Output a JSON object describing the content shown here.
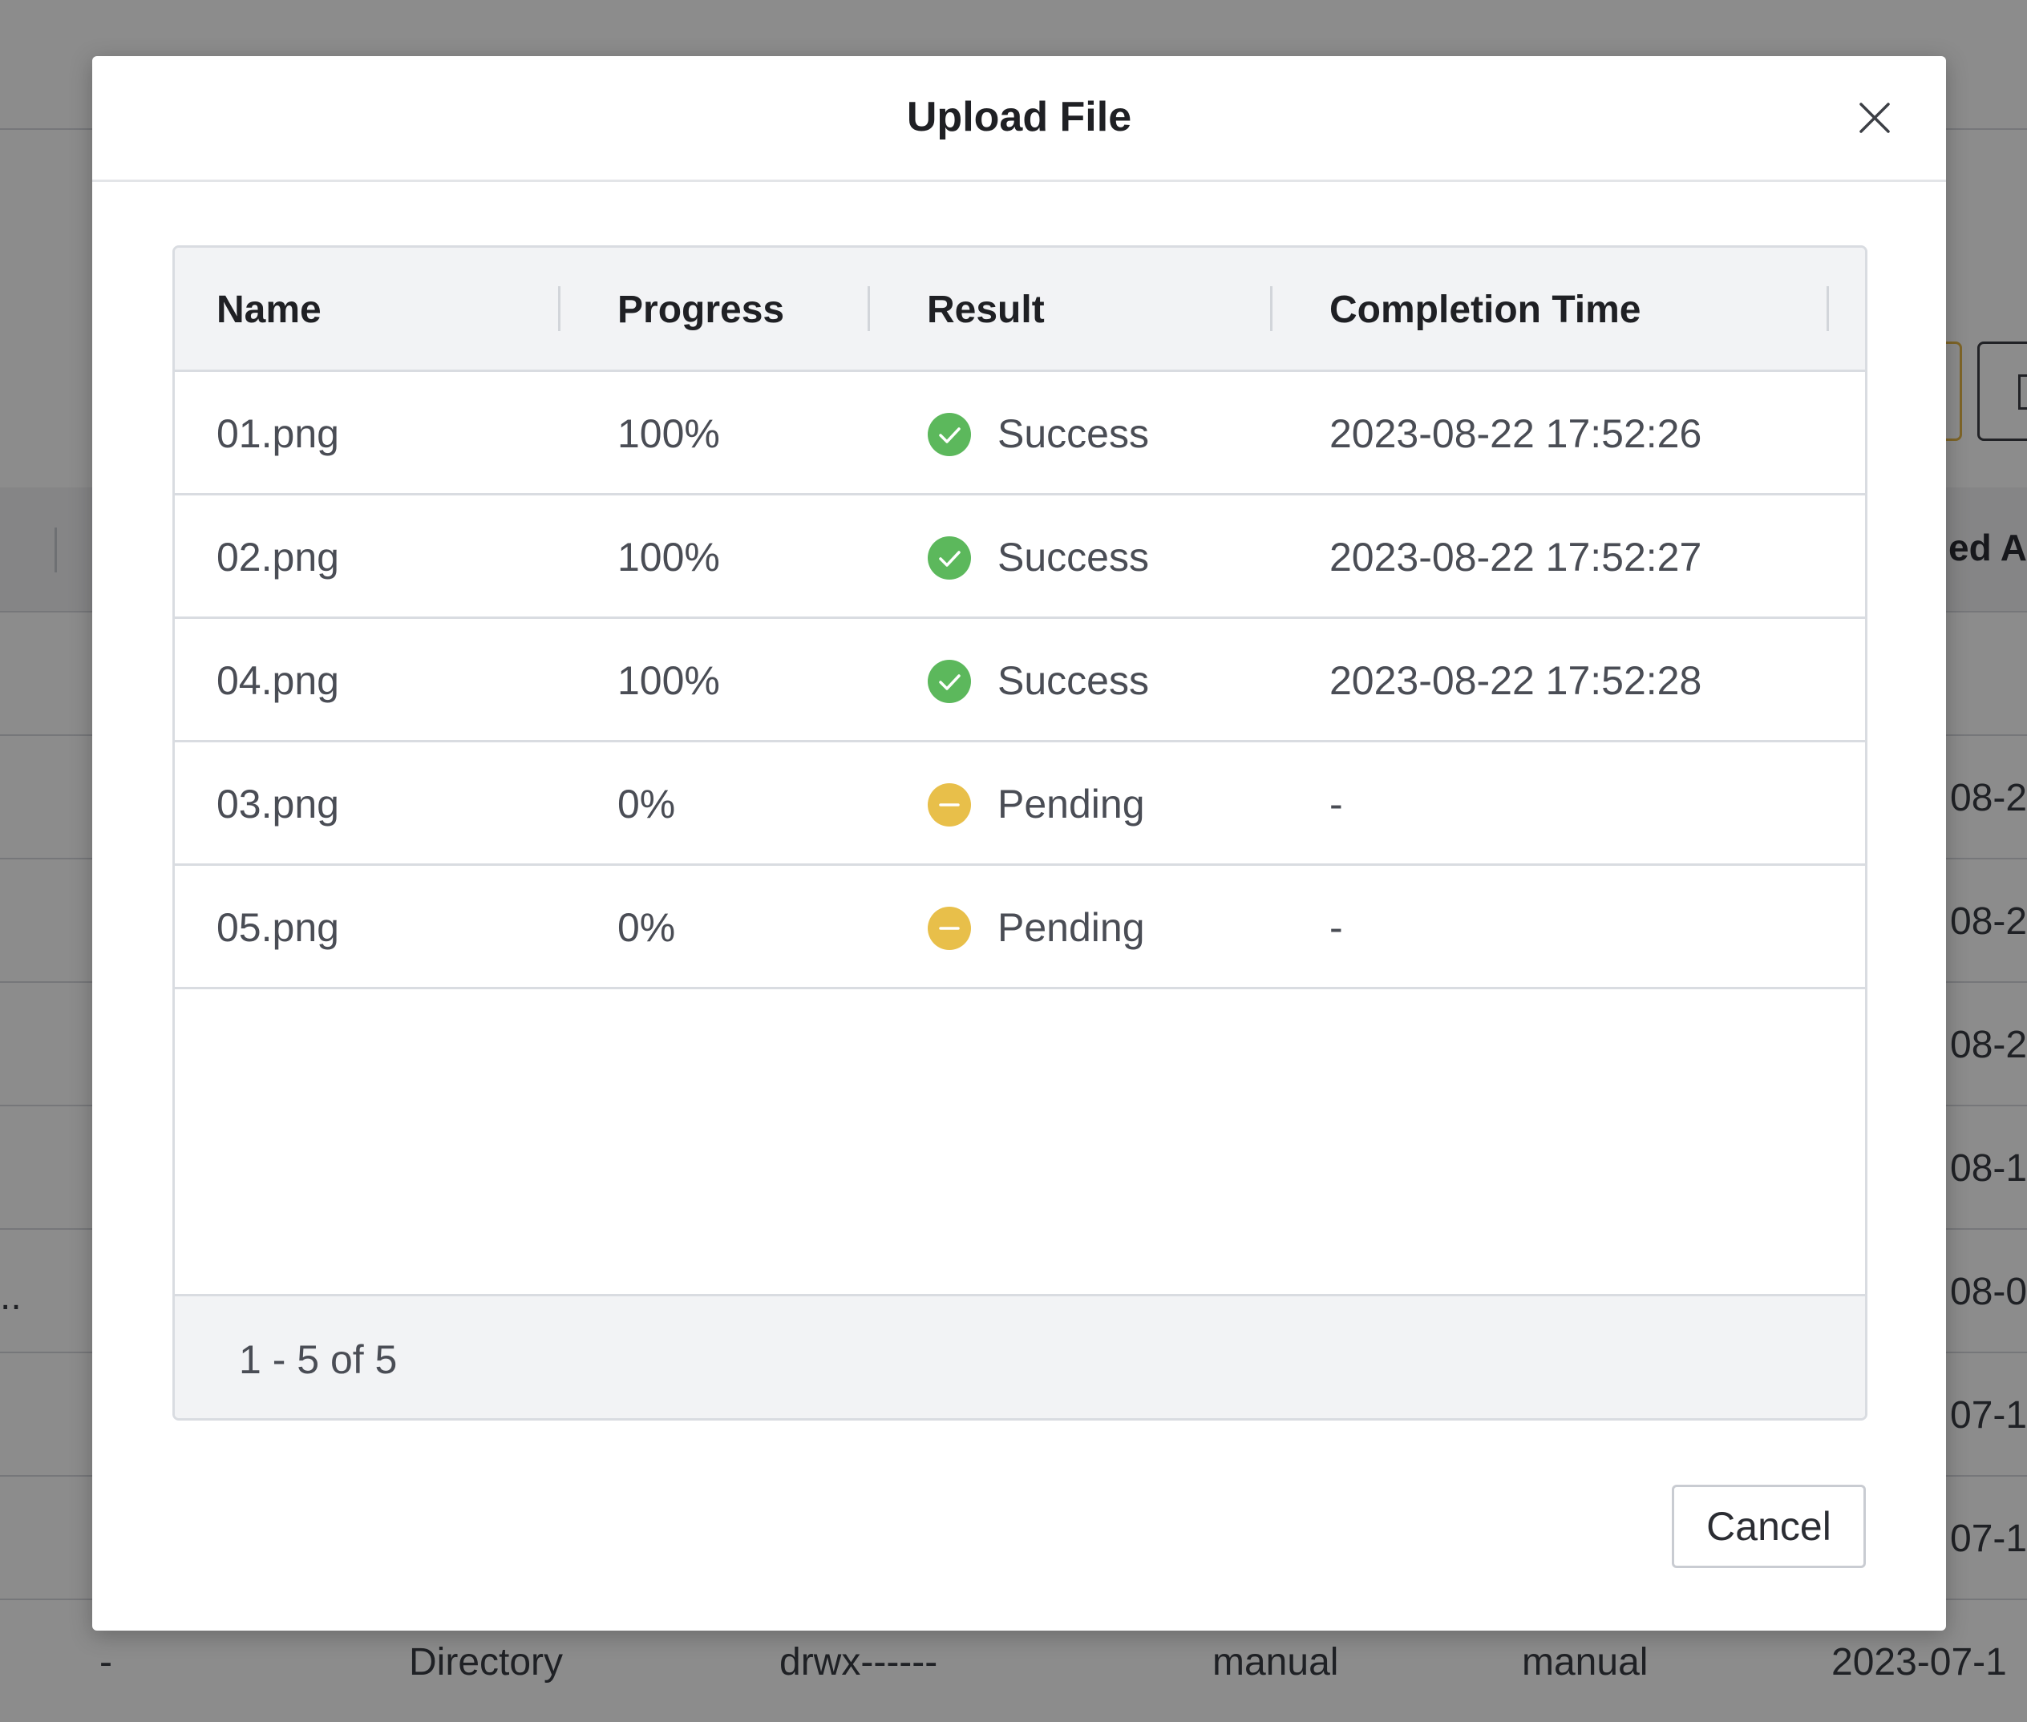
{
  "background": {
    "header_fragment": "ed A",
    "dates": [
      "08-2",
      "08-2",
      "08-2",
      "08-1",
      "08-0",
      "07-1",
      "07-1"
    ],
    "ellipsis": "..",
    "bottom_row": {
      "name": "-",
      "type": "Directory",
      "permissions": "drwx------",
      "owner": "manual",
      "group": "manual",
      "date": "2023-07-1"
    }
  },
  "modal": {
    "title": "Upload File",
    "close_icon": "close-icon",
    "columns": [
      "Name",
      "Progress",
      "Result",
      "Completion Time"
    ],
    "rows": [
      {
        "name": "01.png",
        "progress": "100%",
        "result": "Success",
        "status": "success",
        "completion_time": "2023-08-22 17:52:26"
      },
      {
        "name": "02.png",
        "progress": "100%",
        "result": "Success",
        "status": "success",
        "completion_time": "2023-08-22 17:52:27"
      },
      {
        "name": "04.png",
        "progress": "100%",
        "result": "Success",
        "status": "success",
        "completion_time": "2023-08-22 17:52:28"
      },
      {
        "name": "03.png",
        "progress": "0%",
        "result": "Pending",
        "status": "pending",
        "completion_time": "-"
      },
      {
        "name": "05.png",
        "progress": "0%",
        "result": "Pending",
        "status": "pending",
        "completion_time": "-"
      }
    ],
    "pagination": "1 - 5 of 5",
    "cancel_label": "Cancel"
  },
  "colors": {
    "success": "#5cb85c",
    "pending": "#e8bf4a",
    "overlay": "#000000"
  }
}
